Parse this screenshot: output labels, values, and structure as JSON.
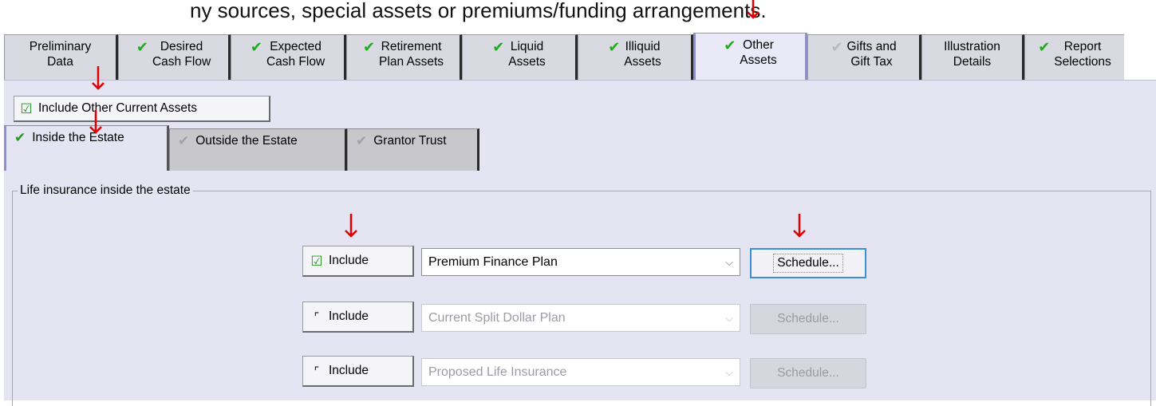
{
  "header_fragment": "ny sources, special assets or premiums/funding arrangements.",
  "tabs": [
    {
      "label": "Preliminary\nData",
      "check": "none",
      "active": false
    },
    {
      "label": "Desired\nCash Flow",
      "check": "green",
      "active": false
    },
    {
      "label": "Expected\nCash Flow",
      "check": "green",
      "active": false
    },
    {
      "label": "Retirement\nPlan Assets",
      "check": "green",
      "active": false
    },
    {
      "label": "Liquid\nAssets",
      "check": "green",
      "active": false
    },
    {
      "label": "Illiquid\nAssets",
      "check": "green",
      "active": false
    },
    {
      "label": "Other\nAssets",
      "check": "green",
      "active": true
    },
    {
      "label": "Gifts and\nGift Tax",
      "check": "grey",
      "active": false
    },
    {
      "label": "Illustration\nDetails",
      "check": "none",
      "active": false
    },
    {
      "label": "Report\nSelections",
      "check": "green",
      "active": false
    }
  ],
  "include_other_current_assets": {
    "label": "Include Other Current Assets",
    "checked": true
  },
  "subtabs": [
    {
      "label": "Inside the Estate",
      "check": "green",
      "active": true
    },
    {
      "label": "Outside the Estate",
      "check": "grey",
      "active": false
    },
    {
      "label": "Grantor Trust",
      "check": "grey",
      "active": false
    }
  ],
  "group": {
    "title": "Life insurance inside the estate",
    "rows": [
      {
        "include_label": "Include",
        "checked": true,
        "plan": "Premium Finance Plan",
        "enabled": true,
        "schedule_label": "Schedule..."
      },
      {
        "include_label": "Include",
        "checked": false,
        "plan": "Current Split Dollar Plan",
        "enabled": false,
        "schedule_label": "Schedule..."
      },
      {
        "include_label": "Include",
        "checked": false,
        "plan": "Proposed Life Insurance",
        "enabled": false,
        "schedule_label": "Schedule..."
      }
    ]
  },
  "colors": {
    "check_green": "#1f9a1f",
    "panel_bg": "#e4e4f2",
    "annotation_red": "#e00000",
    "focus_blue": "#3a8fd8"
  }
}
